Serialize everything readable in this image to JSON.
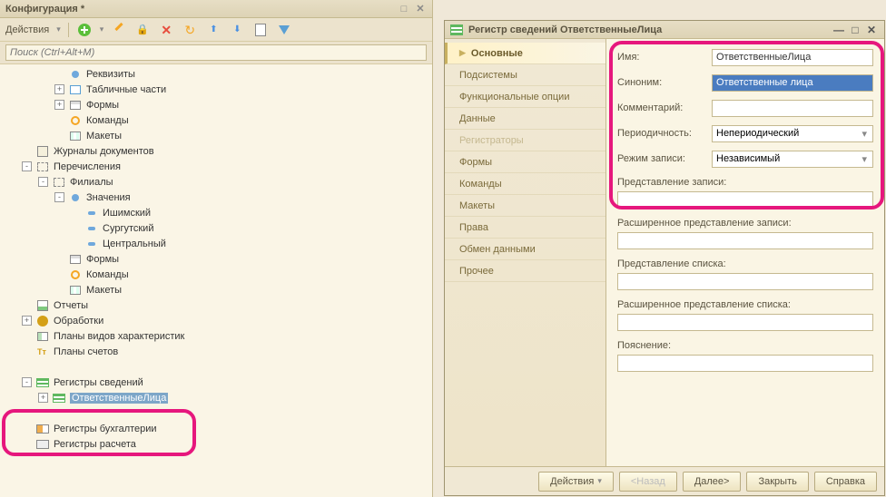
{
  "left": {
    "title": "Конфигурация *",
    "actions_label": "Действия",
    "search_placeholder": "Поиск (Ctrl+Alt+M)",
    "tree": [
      {
        "ind": 2,
        "exp": "",
        "icon": "dot",
        "label": "Реквизиты"
      },
      {
        "ind": 2,
        "exp": "+",
        "icon": "grid",
        "label": "Табличные части"
      },
      {
        "ind": 2,
        "exp": "+",
        "icon": "form",
        "label": "Формы"
      },
      {
        "ind": 2,
        "exp": "",
        "icon": "cmd",
        "label": "Команды"
      },
      {
        "ind": 2,
        "exp": "",
        "icon": "layout",
        "label": "Макеты"
      },
      {
        "ind": 0,
        "exp": "",
        "icon": "journal",
        "label": "Журналы документов"
      },
      {
        "ind": 0,
        "exp": "-",
        "icon": "enum",
        "label": "Перечисления"
      },
      {
        "ind": 1,
        "exp": "-",
        "icon": "enum",
        "label": "Филиалы"
      },
      {
        "ind": 2,
        "exp": "-",
        "icon": "dot",
        "label": "Значения"
      },
      {
        "ind": 3,
        "exp": "",
        "icon": "folder",
        "label": "Ишимский"
      },
      {
        "ind": 3,
        "exp": "",
        "icon": "folder",
        "label": "Сургутский"
      },
      {
        "ind": 3,
        "exp": "",
        "icon": "folder",
        "label": "Центральный"
      },
      {
        "ind": 2,
        "exp": "",
        "icon": "form",
        "label": "Формы"
      },
      {
        "ind": 2,
        "exp": "",
        "icon": "cmd",
        "label": "Команды"
      },
      {
        "ind": 2,
        "exp": "",
        "icon": "layout",
        "label": "Макеты"
      },
      {
        "ind": 0,
        "exp": "",
        "icon": "report",
        "label": "Отчеты"
      },
      {
        "ind": 0,
        "exp": "+",
        "icon": "proc",
        "label": "Обработки"
      },
      {
        "ind": 0,
        "exp": "",
        "icon": "plan",
        "label": "Планы видов характеристик"
      },
      {
        "ind": 0,
        "exp": "",
        "icon": "acct",
        "label": "Планы счетов"
      },
      {
        "ind": 0,
        "exp": "",
        "icon": "common",
        "label": ""
      },
      {
        "ind": 0,
        "exp": "-",
        "icon": "reg-info",
        "label": "Регистры сведений"
      },
      {
        "ind": 1,
        "exp": "+",
        "icon": "reg-info",
        "label": "ОтветственныеЛица",
        "selected": true
      },
      {
        "ind": 0,
        "exp": "",
        "icon": "common",
        "label": ""
      },
      {
        "ind": 0,
        "exp": "",
        "icon": "reg-acc",
        "label": "Регистры бухгалтерии"
      },
      {
        "ind": 0,
        "exp": "",
        "icon": "reg-calc",
        "label": "Регистры расчета"
      }
    ]
  },
  "dialog": {
    "title": "Регистр сведений ОтветственныеЛица",
    "tabs": [
      {
        "label": "Основные",
        "active": true
      },
      {
        "label": "Подсистемы"
      },
      {
        "label": "Функциональные опции"
      },
      {
        "label": "Данные"
      },
      {
        "label": "Регистраторы",
        "disabled": true
      },
      {
        "label": "Формы"
      },
      {
        "label": "Команды"
      },
      {
        "label": "Макеты"
      },
      {
        "label": "Права"
      },
      {
        "label": "Обмен данными"
      },
      {
        "label": "Прочее"
      }
    ],
    "fields": {
      "name_label": "Имя:",
      "name_value": "ОтветственныеЛица",
      "synonym_label": "Синоним:",
      "synonym_value": "Ответственные лица",
      "comment_label": "Комментарий:",
      "comment_value": "",
      "periodicity_label": "Периодичность:",
      "periodicity_value": "Непериодический",
      "writemode_label": "Режим записи:",
      "writemode_value": "Независимый",
      "record_pres_label": "Представление записи:",
      "record_ext_pres_label": "Расширенное представление записи:",
      "list_pres_label": "Представление списка:",
      "list_ext_pres_label": "Расширенное представление списка:",
      "explanation_label": "Пояснение:"
    },
    "footer": {
      "actions": "Действия",
      "back": "<Назад",
      "next": "Далее>",
      "close": "Закрыть",
      "help": "Справка"
    }
  }
}
